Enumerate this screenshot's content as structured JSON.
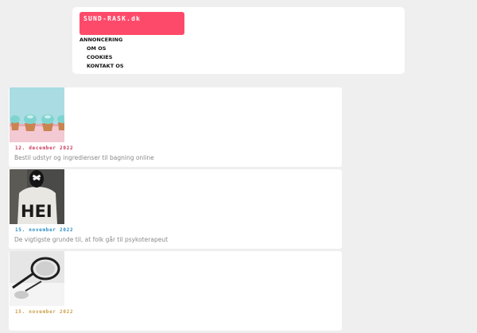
{
  "site": {
    "logo": "SUND-RASK.dk"
  },
  "nav": {
    "items": [
      {
        "label": "ANNONCERING"
      },
      {
        "label": "OM OS"
      },
      {
        "label": "COOKIES"
      },
      {
        "label": "KONTAKT OS"
      }
    ]
  },
  "posts": [
    {
      "date": "12. december 2022",
      "date_color": "#c8365c",
      "title": "Bestil udstyr og ingredienser til bagning online",
      "image_icon": "cupcakes-photo"
    },
    {
      "date": "15. november 2022",
      "date_color": "#2a8fc4",
      "title": "De vigtigste grunde til, at folk går til psykoterapeut",
      "image_icon": "hei-tshirt-person-photo"
    },
    {
      "date": "15. november 2022",
      "date_color": "#c9a04a",
      "title": "",
      "image_icon": "glasses-photo"
    }
  ],
  "colors": {
    "background": "#efefef",
    "logo_background": "#fe4a6a"
  }
}
